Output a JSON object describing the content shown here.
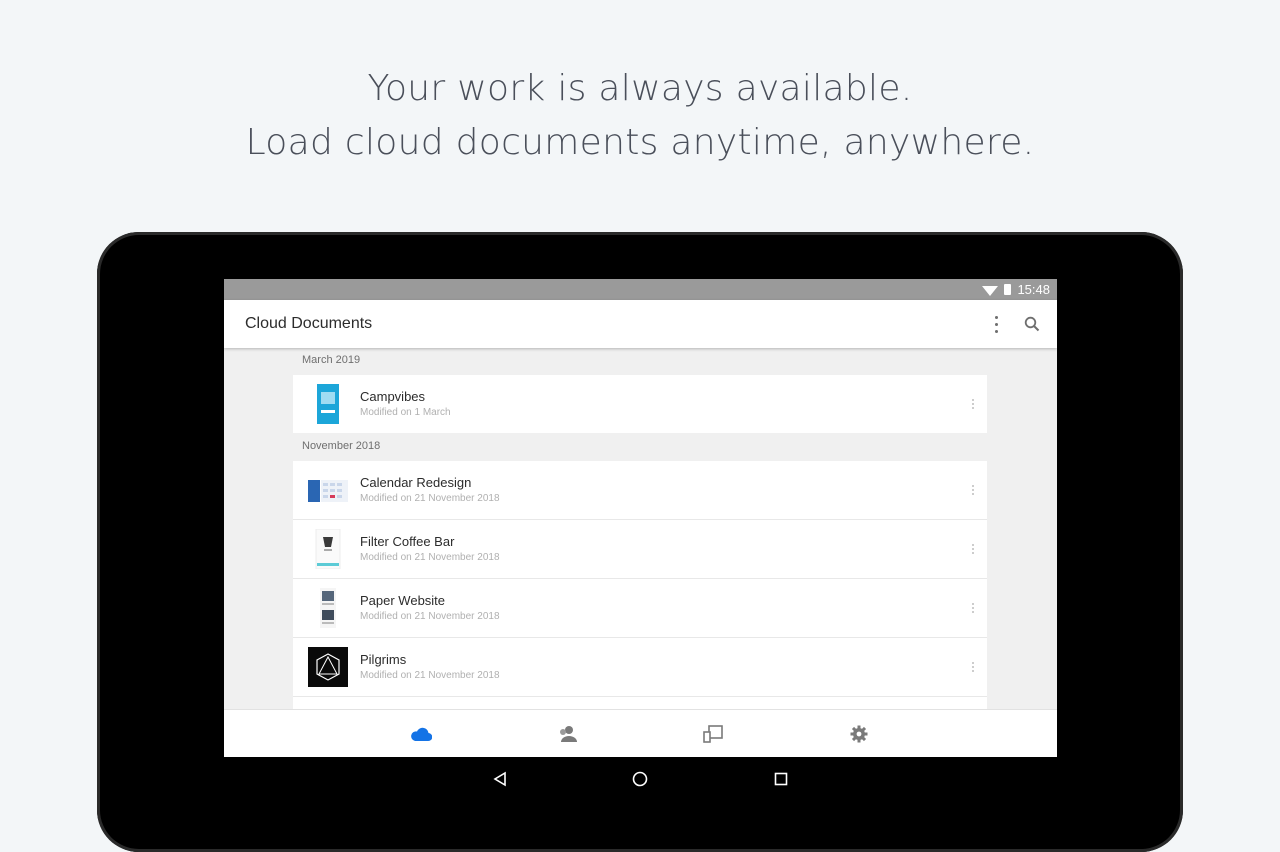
{
  "headline": {
    "line1": "Your work is always available.",
    "line2": "Load cloud documents anytime, anywhere."
  },
  "status_bar": {
    "time": "15:48",
    "icons": [
      "wifi-icon",
      "battery-icon"
    ]
  },
  "app_bar": {
    "title": "Cloud Documents",
    "actions": [
      "more-options-icon",
      "search-icon"
    ]
  },
  "sections": [
    {
      "label": "March 2019",
      "documents": [
        {
          "name": "Campvibes",
          "modified": "Modified on 1 March"
        }
      ]
    },
    {
      "label": "November 2018",
      "documents": [
        {
          "name": "Calendar Redesign",
          "modified": "Modified on 21 November 2018"
        },
        {
          "name": "Filter Coffee Bar",
          "modified": "Modified on 21 November 2018"
        },
        {
          "name": "Paper Website",
          "modified": "Modified on 21 November 2018"
        },
        {
          "name": "Pilgrims",
          "modified": "Modified on 21 November 2018"
        }
      ]
    }
  ],
  "bottom_nav": {
    "items": [
      "cloud-icon",
      "people-icon",
      "devices-icon",
      "settings-icon"
    ],
    "active_index": 0,
    "active_color": "#1473e6",
    "inactive_color": "#7a7a7a"
  },
  "system_nav": [
    "back-icon",
    "home-icon",
    "recents-icon"
  ]
}
